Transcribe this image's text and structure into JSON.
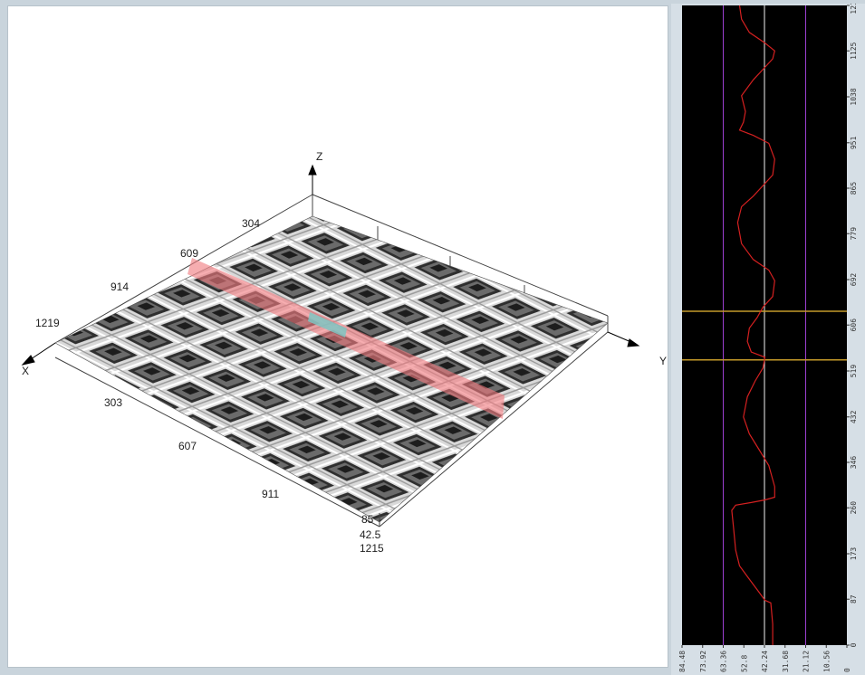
{
  "view3d": {
    "axis_titles": {
      "x": "X",
      "y": "Y",
      "z": "Z"
    },
    "x_ticks": [
      "303",
      "607",
      "911",
      "1215"
    ],
    "y_ticks": [
      "304",
      "609",
      "914",
      "1219"
    ],
    "z_ticks": [
      "85",
      "42.5"
    ],
    "profile_band_color": "#f07b80",
    "selection_color": "#7fc4c2"
  },
  "chart_data": {
    "type": "line",
    "title": "",
    "ylim": [
      0,
      1211
    ],
    "xlim": [
      84.48,
      0
    ],
    "y_ticks": [
      "0",
      "87",
      "173",
      "260",
      "346",
      "432",
      "519",
      "606",
      "692",
      "779",
      "865",
      "951",
      "1038",
      "1125",
      "1211"
    ],
    "x_ticks": [
      "84.48",
      "73.92",
      "63.36",
      "52.8",
      "42.24",
      "31.68",
      "21.12",
      "10.56",
      "0"
    ],
    "guides": {
      "vertical": [
        63.36,
        42.24,
        21.12
      ],
      "horizontal": [
        540,
        632
      ]
    },
    "series": [
      {
        "color": "#d42020",
        "points": [
          [
            38,
            0
          ],
          [
            38,
            40
          ],
          [
            39,
            80
          ],
          [
            42,
            85
          ],
          [
            45,
            100
          ],
          [
            51,
            130
          ],
          [
            55,
            150
          ],
          [
            57,
            180
          ],
          [
            58,
            220
          ],
          [
            59,
            255
          ],
          [
            57,
            265
          ],
          [
            49,
            270
          ],
          [
            42,
            275
          ],
          [
            37,
            280
          ],
          [
            37,
            300
          ],
          [
            40,
            340
          ],
          [
            45,
            370
          ],
          [
            50,
            400
          ],
          [
            53,
            432
          ],
          [
            51,
            470
          ],
          [
            47,
            500
          ],
          [
            43,
            525
          ],
          [
            42,
            545
          ],
          [
            49,
            555
          ],
          [
            51,
            575
          ],
          [
            50,
            600
          ],
          [
            46,
            620
          ],
          [
            43,
            640
          ],
          [
            38,
            660
          ],
          [
            37,
            690
          ],
          [
            40,
            710
          ],
          [
            48,
            730
          ],
          [
            54,
            760
          ],
          [
            56,
            800
          ],
          [
            54,
            830
          ],
          [
            48,
            850
          ],
          [
            43,
            870
          ],
          [
            38,
            890
          ],
          [
            37,
            920
          ],
          [
            40,
            950
          ],
          [
            48,
            965
          ],
          [
            55,
            975
          ],
          [
            53,
            990
          ],
          [
            52,
            1010
          ],
          [
            54,
            1040
          ],
          [
            48,
            1070
          ],
          [
            43,
            1090
          ],
          [
            38,
            1110
          ],
          [
            37,
            1125
          ],
          [
            42,
            1140
          ],
          [
            50,
            1160
          ],
          [
            54,
            1185
          ],
          [
            55,
            1211
          ]
        ]
      }
    ]
  }
}
